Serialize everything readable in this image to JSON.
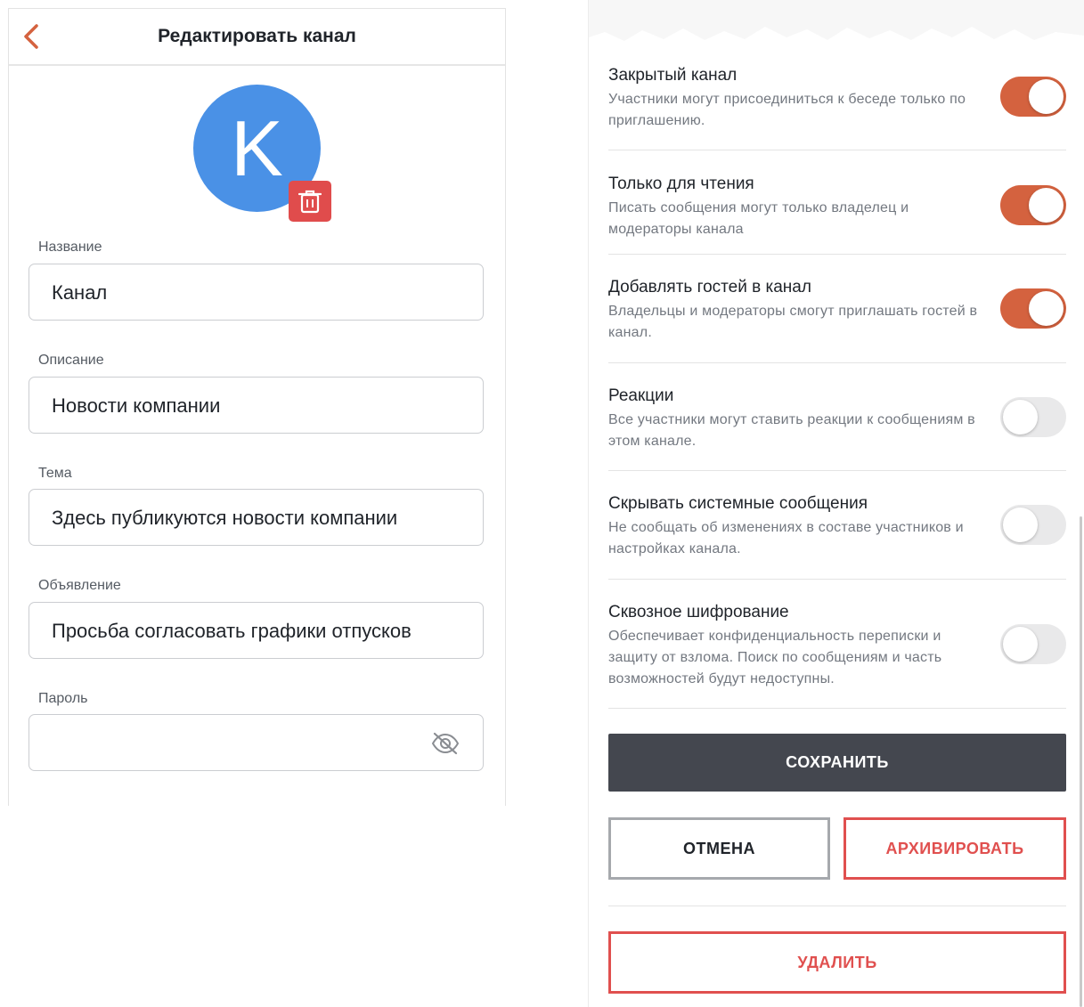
{
  "edit_screen": {
    "title": "Редактировать канал",
    "avatar_letter": "K",
    "fields": [
      {
        "label": "Название",
        "value": "Канал"
      },
      {
        "label": "Описание",
        "value": "Новости компании"
      },
      {
        "label": "Тема",
        "value": "Здесь публикуются новости компании"
      },
      {
        "label": "Объявление",
        "value": "Просьба согласовать графики отпусков"
      },
      {
        "label": "Пароль",
        "value": ""
      }
    ]
  },
  "settings": {
    "items": [
      {
        "title": "Закрытый канал",
        "description": "Участники могут присоединиться к беседе только по приглашению.",
        "enabled": true
      },
      {
        "title": "Только для чтения",
        "description": "Писать сообщения могут только владелец и модераторы канала",
        "enabled": true
      },
      {
        "title": "Добавлять гостей в канал",
        "description": "Владельцы и модераторы смогут приглашать гостей в канал.",
        "enabled": true
      },
      {
        "title": "Реакции",
        "description": "Все участники могут ставить реакции к сообщениям в этом канале.",
        "enabled": false
      },
      {
        "title": "Скрывать системные сообщения",
        "description": "Не сообщать об изменениях в составе участников и настройках канала.",
        "enabled": false
      },
      {
        "title": "Сквозное шифрование",
        "description": "Обеспечивает конфиденциальность переписки и защиту от взлома. Поиск по сообщениям и часть возможностей будут недоступны.",
        "enabled": false
      }
    ]
  },
  "actions": {
    "save": "СОХРАНИТЬ",
    "cancel": "ОТМЕНА",
    "archive": "АРХИВИРОВАТЬ",
    "delete": "УДАЛИТЬ"
  },
  "icons": {
    "back": "chevron-left-icon",
    "delete_avatar": "trash-icon",
    "password_visibility": "eye-off-icon"
  },
  "colors": {
    "accent": "#d4623f",
    "avatar": "#4a91e6",
    "danger": "#e0504f",
    "primary_button": "#44474f"
  }
}
